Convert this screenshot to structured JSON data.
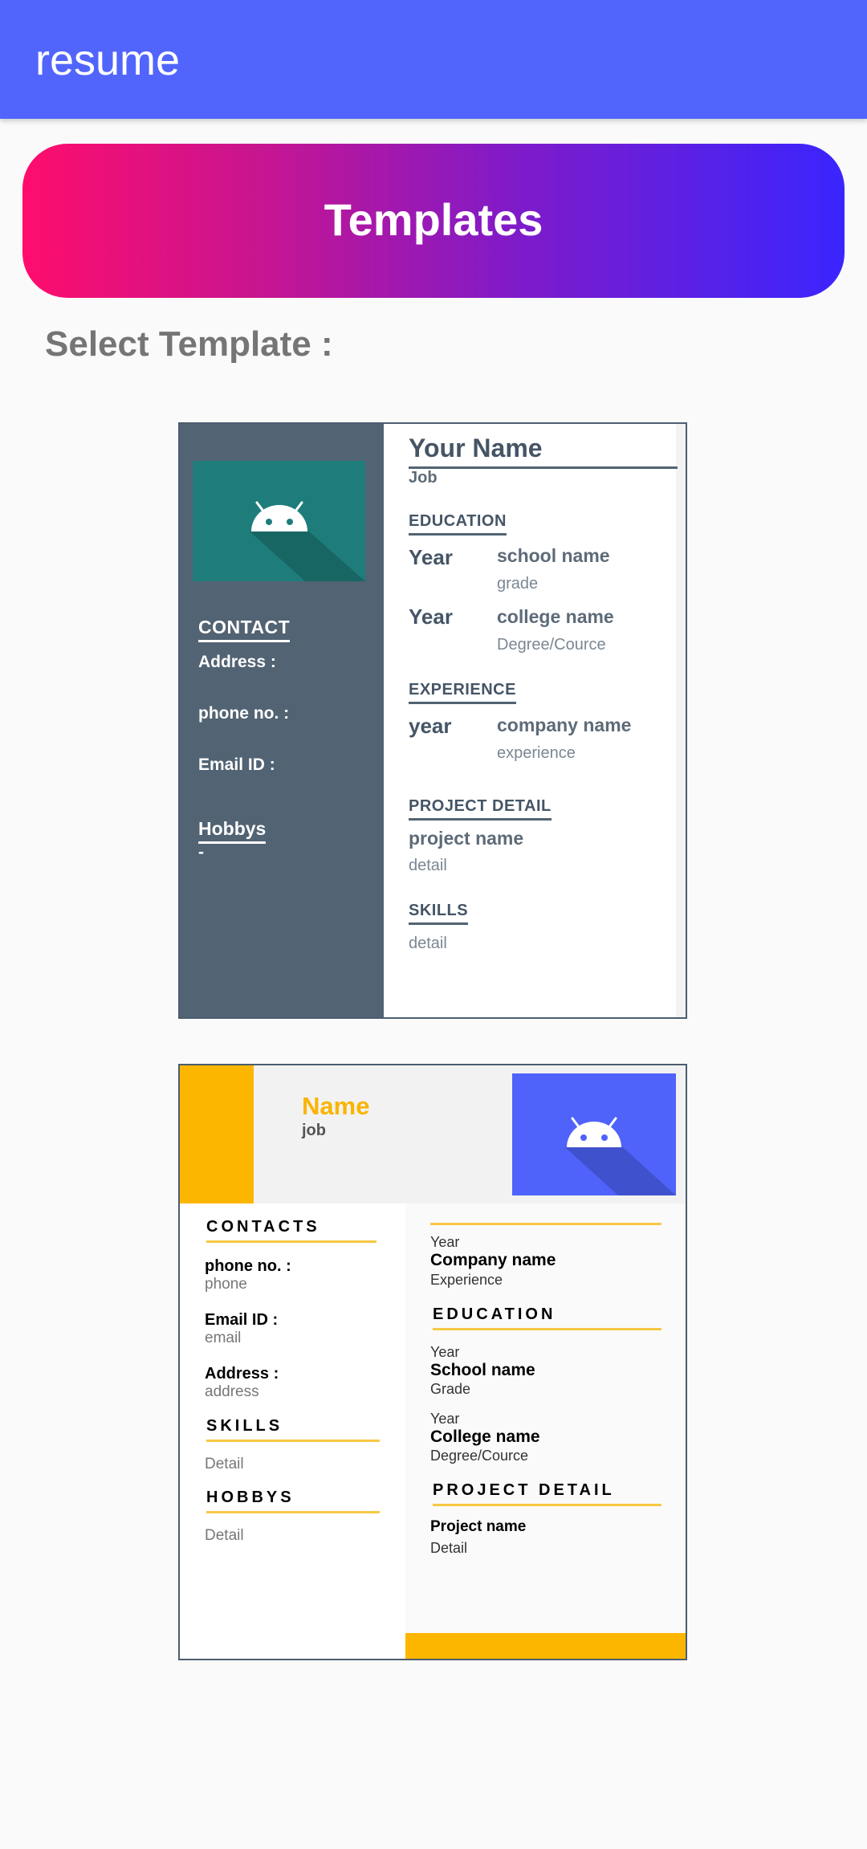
{
  "app_bar": {
    "title": "resume",
    "color": "#5165fc"
  },
  "banner": {
    "title": "Templates"
  },
  "select_label": "Select Template :",
  "template1": {
    "name": "Your Name",
    "job": "Job",
    "contact_heading": "CONTACT",
    "address_label": "Address :",
    "phone_label": "phone no. :",
    "email_label": "Email ID :",
    "hobbys_heading": "Hobbys",
    "hobbys_value": "-",
    "education_heading": "EDUCATION",
    "edu": [
      {
        "year": "Year",
        "name": "school name",
        "detail": "grade"
      },
      {
        "year": "Year",
        "name": "college name",
        "detail": "Degree/Cource"
      }
    ],
    "experience_heading": "EXPERIENCE",
    "exp": {
      "year": "year",
      "name": "company name",
      "detail": "experience"
    },
    "project_heading": "PROJECT DETAIL",
    "project": {
      "name": "project name",
      "detail": "detail"
    },
    "skills_heading": "SKILLS",
    "skills_detail": "detail",
    "photo_icon": "android-icon"
  },
  "template2": {
    "name": "Name",
    "job": "job",
    "contacts_heading": "CONTACTS",
    "phone_label": "phone no. :",
    "phone_value": "phone",
    "email_label": "Email ID :",
    "email_value": "email",
    "address_label": "Address :",
    "address_value": "address",
    "skills_heading": "SKILLS",
    "skills_detail": "Detail",
    "hobbys_heading": "HOBBYS",
    "hobbys_detail": "Detail",
    "exp": {
      "year": "Year",
      "name": "Company name",
      "detail": "Experience"
    },
    "education_heading": "EDUCATION",
    "edu": [
      {
        "year": "Year",
        "name": "School name",
        "detail": "Grade"
      },
      {
        "year": "Year",
        "name": "College name",
        "detail": "Degree/Cource"
      }
    ],
    "project_heading": "PROJECT DETAIL",
    "project": {
      "name": "Project name",
      "detail": "Detail"
    },
    "accent": "#fdb600",
    "photo_icon": "android-icon"
  }
}
